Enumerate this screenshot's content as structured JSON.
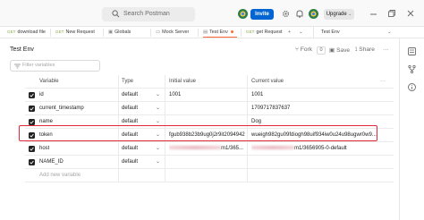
{
  "titlebar": {
    "search_placeholder": "Search Postman",
    "invite_label": "Invite",
    "upgrade_label": "Upgrade"
  },
  "tabs": [
    {
      "method": "GET",
      "label": "download file"
    },
    {
      "method": "GET",
      "label": "New Request"
    },
    {
      "method": "",
      "label": "Globals"
    },
    {
      "method": "",
      "label": "Mock Server"
    },
    {
      "method": "",
      "label": "Test Env"
    },
    {
      "method": "GET",
      "label": "get Request"
    }
  ],
  "env_select": "Test Env",
  "environment": {
    "title": "Test Env",
    "fork_label": "Fork",
    "fork_count": "0",
    "save_label": "Save",
    "share_label": "Share",
    "filter_placeholder": "Filter variables"
  },
  "table": {
    "headers": [
      "Variable",
      "Type",
      "Initial value",
      "Current value"
    ],
    "rows": [
      {
        "variable": "id",
        "type": "default",
        "initial": "1001",
        "current": "1001"
      },
      {
        "variable": "current_timestamp",
        "type": "default",
        "initial": "",
        "current": "1709717837637"
      },
      {
        "variable": "name",
        "type": "default",
        "initial": "",
        "current": "Dog"
      },
      {
        "variable": "token",
        "type": "default",
        "initial": "fgub938b23b9ug0j2r9it2094942",
        "current": "wueigh982gu09fdiogh98uif934iw0u24u98ugwr0w9..."
      },
      {
        "variable": "host",
        "type": "default",
        "initial": "m1/365...",
        "current": "m1/3656905-0-default"
      },
      {
        "variable": "NAME_ID",
        "type": "default",
        "initial": "",
        "current": ""
      }
    ],
    "add_placeholder": "Add new variable"
  }
}
